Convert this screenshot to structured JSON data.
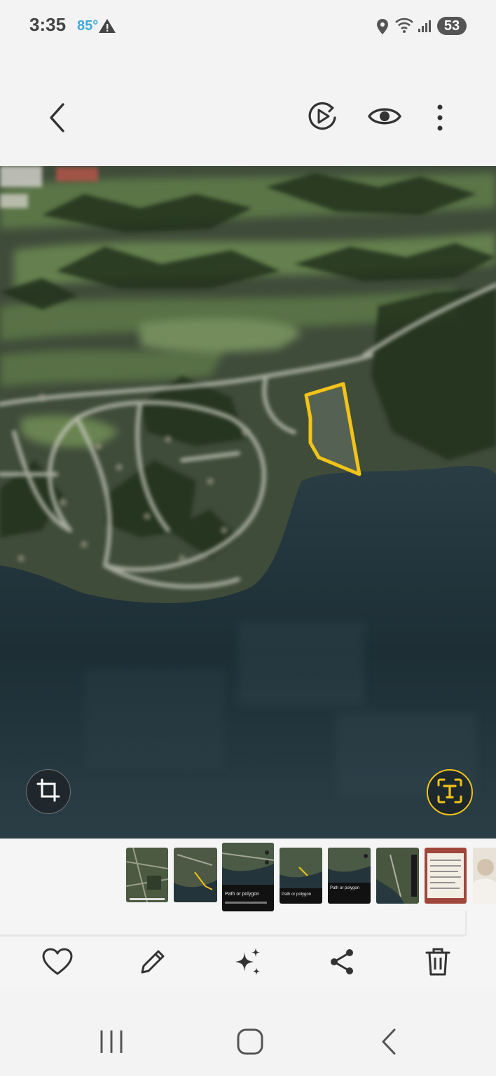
{
  "status_bar": {
    "time": "3:35",
    "temperature": "85°",
    "battery": "53",
    "icons": [
      "alert-icon",
      "location-icon",
      "wifi-icon",
      "signal-icon",
      "battery-icon"
    ]
  },
  "top_bar": {
    "icons": [
      "back-icon",
      "motion-photo-icon",
      "view-icon",
      "more-options-icon"
    ]
  },
  "viewer": {
    "colors": {
      "water": "#1c2b33",
      "land": "#3b4a35",
      "highlight": "#f2c318"
    }
  },
  "overlay_buttons": {
    "icons": [
      "crop-icon",
      "extract-text-icon"
    ]
  },
  "filmstrip": {
    "selected_index": 2,
    "thumbnails": [
      {
        "caption": ""
      },
      {
        "caption": ""
      },
      {
        "caption": "Path or polygon"
      },
      {
        "caption": "Path or polygon"
      },
      {
        "caption": "Path or polygon"
      },
      {
        "caption": ""
      },
      {
        "caption": ""
      },
      {
        "caption": ""
      }
    ]
  },
  "actions": {
    "icons": [
      "favorite-icon",
      "edit-icon",
      "effects-icon",
      "share-icon",
      "delete-icon"
    ]
  },
  "navbar": {
    "icons": [
      "recent-apps-icon",
      "home-icon",
      "nav-back-icon"
    ]
  }
}
